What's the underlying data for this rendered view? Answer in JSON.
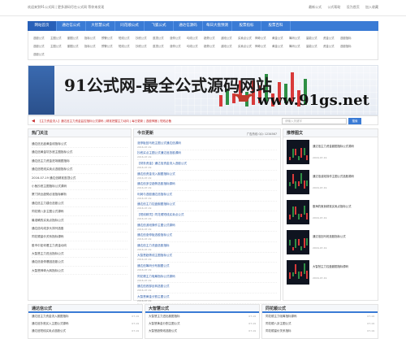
{
  "topbar": {
    "left_text": "欢迎来到91公式网 | 更多源码尽在公式网 等你来发现",
    "links": [
      "最新公式",
      "公式帮助",
      "设为首页",
      "加入收藏"
    ]
  },
  "nav": {
    "items": [
      "网站首页",
      "通达信公式",
      "大智慧公式",
      "同花顺公式",
      "飞狐公式",
      "通达信源码",
      "每日大盘预测",
      "股票指标",
      "股票百科"
    ]
  },
  "subnav": {
    "rows": [
      [
        "选股公式",
        "主图公式",
        "副图公式",
        "指标公式",
        "预警公式",
        "短线公式",
        "抄底公式",
        "逃顶公式",
        "涨停公式",
        "均线公式",
        "趋势公式",
        "波段公式",
        "买卖点公式",
        "神奇公式",
        "黄金公式",
        "筹码公式",
        "量能公式",
        "资金公式",
        "选股指标"
      ],
      [
        "选股公式",
        "主图公式",
        "副图公式",
        "指标公式",
        "预警公式",
        "短线公式",
        "抄底公式",
        "逃顶公式",
        "涨停公式",
        "均线公式",
        "趋势公式",
        "波段公式",
        "买卖点公式",
        "神奇公式",
        "黄金公式",
        "筹码公式",
        "量能公式",
        "资金公式",
        "选股指标"
      ],
      [
        "选股公式"
      ]
    ]
  },
  "banner": {
    "title": "91公式网-最全公式源码网站",
    "url": "www.91gs.net"
  },
  "ticker": {
    "text": "【主力资金流入】通达信主力资金监控指标公式源码 | 精准把握主力动向 | 每日更新 | 选股神器 | 短线必备",
    "search_placeholder": "请输入关键字",
    "search_button": "搜索"
  },
  "hot": {
    "title": "热门关注",
    "items": [
      "通达信无敌黄金线指标公式",
      "通达信黄金坑抄底主图指标公式",
      "通达信主力资金进场副图指标",
      "通达信短线买卖点选股指标公式",
      "2016-07-19 通达信精准逃顶公式",
      "小鱼抄底主图指标公式源码",
      "厦门钨业趋势必涨指标解析",
      "通达信主力建仓选股公式",
      "同花顺八卦主图公式源码",
      "最准确的买卖点指标公式",
      "通达信均线多头排列选股",
      "同花顺量价关系指标源码",
      "股市中如何看主力资金动向",
      "大智慧主力进出指标公式",
      "通达信涨停基因选股公式",
      "大智慧神奇九转指标公式"
    ]
  },
  "today": {
    "title": "今日更新",
    "extra": "广告热线 QQ: 1234567",
    "items": [
      {
        "a": "涨停板回马枪主图公式通达信源码",
        "d": "2016-07-19"
      },
      {
        "a": "抄底买点主图公式通达信选股源码",
        "d": "2016-07-19"
      },
      {
        "a": "【财务资金】通达信资金流入选股公式",
        "d": "2016-07-19"
      },
      {
        "a": "通达信资金流入副图指标公式",
        "d": "2016-07-19"
      },
      {
        "a": "通达信多空趋势选股指标源码",
        "d": "2016-07-19"
      },
      {
        "a": "利润与选股通达信指标公式",
        "d": "2016-07-19"
      },
      {
        "a": "通达信主力控盘副图指标公式",
        "d": "2016-07-19"
      },
      {
        "a": "【短线精灵】同花顺短线买卖点公式",
        "d": "2016-07-19"
      },
      {
        "a": "通达信波段操作主图公式源码",
        "d": "2016-07-19"
      },
      {
        "a": "通达信涨停板选股指标公式",
        "d": "2016-07-19"
      },
      {
        "a": "通达信主力洗盘选股指标",
        "d": "2016-07-19"
      },
      {
        "a": "大智慧趋势线主图指标公式",
        "d": "2016-07-19"
      },
      {
        "a": "通达信筹码分布副图公式",
        "d": "2016-07-19"
      },
      {
        "a": "同花顺主力吸筹指标公式源码",
        "d": "2016-07-19"
      },
      {
        "a": "通达信底部反转选股公式",
        "d": "2016-07-19"
      },
      {
        "a": "大智慧黄金分割主图公式",
        "d": "2016-07-19"
      }
    ]
  },
  "recommend": {
    "title": "推荐图文",
    "items": [
      {
        "cap": "通达信主力资金副图指标公式源码",
        "sub": "2016-07-19"
      },
      {
        "cap": "通达信波段操作主图公式选股源码",
        "sub": "2016-07-19"
      },
      {
        "cap": "股海钓鱼翁精准买卖点指标公式",
        "sub": "2016-07-19"
      },
      {
        "cap": "通达信回马枪选股指标公式",
        "sub": "2016-07-19"
      },
      {
        "cap": "大智慧主力控盘副图指标源码",
        "sub": "2016-07-19"
      }
    ]
  },
  "bottom": {
    "col1": {
      "title": "通达信公式",
      "rows": [
        {
          "t": "通达信主力资金流入副图指标",
          "d": "07-19"
        },
        {
          "t": "通达信抄底买入主图公式源码",
          "d": "07-19"
        },
        {
          "t": "通达信短线买卖点选股公式",
          "d": "07-19"
        }
      ]
    },
    "col2": {
      "title": "大智慧公式",
      "rows": [
        {
          "t": "大智慧主力进出副图指标",
          "d": "07-19"
        },
        {
          "t": "大智慧黄金分割主图公式",
          "d": "07-19"
        },
        {
          "t": "大智慧趋势线选股公式",
          "d": "07-19"
        }
      ]
    },
    "col3": {
      "title": "同花顺公式",
      "rows": [
        {
          "t": "同花顺主力吸筹指标源码",
          "d": "07-19"
        },
        {
          "t": "同花顺八卦主图公式",
          "d": "07-19"
        },
        {
          "t": "同花顺量价关系指标",
          "d": "07-19"
        }
      ]
    }
  },
  "colors": {
    "nav": "#3a7bd5",
    "ticker_text": "#c62828",
    "candle_up": "#d93a3a",
    "candle_down": "#2e8f45"
  }
}
